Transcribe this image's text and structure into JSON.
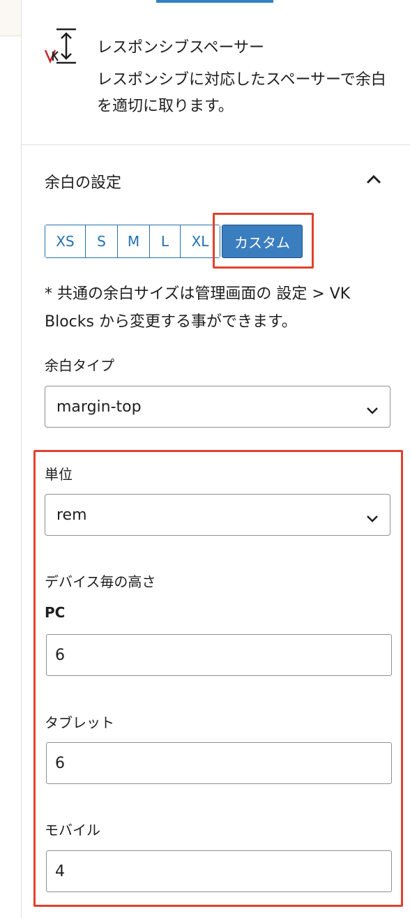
{
  "block": {
    "icon": "responsive-spacer-icon",
    "title": "レスポンシブスペーサー",
    "description": "レスポンシブに対応したスペーサーで余白を適切に取ります。"
  },
  "panel": {
    "title": "余白の設定",
    "toggle_icon": "chevron-up-icon"
  },
  "size_buttons": [
    "XS",
    "S",
    "M",
    "L",
    "XL"
  ],
  "custom_button": "カスタム",
  "note": "* 共通の余白サイズは管理画面の 設定 > VK Blocks から変更する事ができます。",
  "margin_type": {
    "label": "余白タイプ",
    "value": "margin-top"
  },
  "unit": {
    "label": "単位",
    "value": "rem"
  },
  "device_heights": {
    "heading": "デバイス毎の高さ",
    "pc_label": "PC",
    "pc_value": "6",
    "tablet_label": "タブレット",
    "tablet_value": "6",
    "mobile_label": "モバイル",
    "mobile_value": "4"
  },
  "colors": {
    "accent": "#2271b1",
    "custom_button_bg": "#3b7ec0",
    "highlight": "#e0412d"
  }
}
